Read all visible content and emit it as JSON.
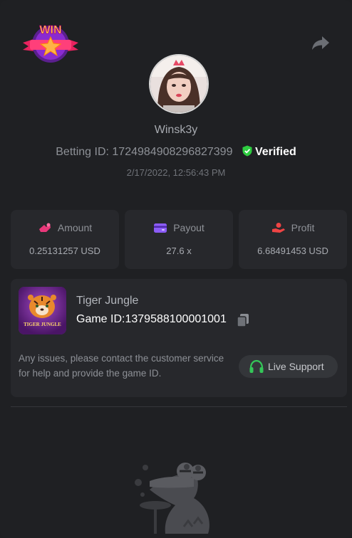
{
  "badge": {
    "text": "WIN"
  },
  "user": {
    "name": "Winsk3y"
  },
  "bet": {
    "id_label": "Betting ID:",
    "id_value": "1724984908296827399",
    "verified": "Verified",
    "datetime": "2/17/2022, 12:56:43 PM"
  },
  "stats": {
    "amount": {
      "label": "Amount",
      "value": "0.25131257 USD"
    },
    "payout": {
      "label": "Payout",
      "value": "27.6 x"
    },
    "profit": {
      "label": "Profit",
      "value": "6.68491453 USD"
    }
  },
  "game": {
    "name": "Tiger Jungle",
    "id_label": "Game ID:",
    "id_value": "1379588100001001",
    "thumb_text": "TIGER JUNGLE",
    "note": "Any issues, please contact the customer service for help and provide the game ID.",
    "support_label": "Live Support"
  },
  "colors": {
    "verified": "#2ecc40",
    "amount_icon": "#e9387a",
    "payout_icon": "#8b5cf6",
    "profit_icon": "#ef4444",
    "support_icon": "#34c759"
  },
  "icons": [
    "win-badge-icon",
    "share-icon",
    "verified-shield-icon",
    "amount-icon",
    "payout-card-icon",
    "profit-hand-icon",
    "copy-icon",
    "headset-icon",
    "crocodile-mascot"
  ]
}
